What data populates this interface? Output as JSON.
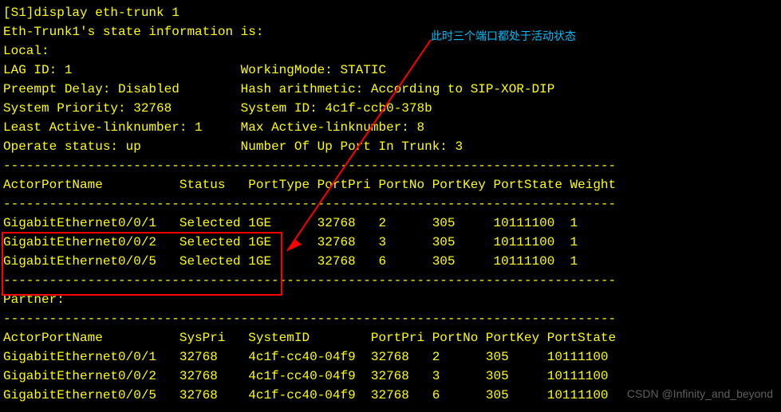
{
  "command": "[S1]display eth-trunk 1",
  "header": "Eth-Trunk1's state information is:",
  "annotation": "此时三个端口都处于活动状态",
  "local_label": "Local:",
  "info": {
    "lag_id_label": "LAG ID: 1",
    "working_mode_label": "WorkingMode: STATIC",
    "preempt_label": "Preempt Delay: Disabled",
    "hash_label": "Hash arithmetic: According to SIP-XOR-DIP",
    "sys_priority_label": "System Priority: 32768",
    "sys_id_label": "System ID: 4c1f-ccb0-378b",
    "least_active_label": "Least Active-linknumber: 1",
    "max_active_label": "Max Active-linknumber: 8",
    "operate_status_label": "Operate status: up",
    "up_ports_label": "Number Of Up Port In Trunk: 3"
  },
  "divider": "--------------------------------------------------------------------------------",
  "actor_headers": "ActorPortName          Status   PortType PortPri PortNo PortKey PortState Weight",
  "actor_rows": [
    "GigabitEthernet0/0/1   Selected 1GE      32768   2      305     10111100  1",
    "GigabitEthernet0/0/2   Selected 1GE      32768   3      305     10111100  1",
    "GigabitEthernet0/0/5   Selected 1GE      32768   6      305     10111100  1"
  ],
  "partner_label": "Partner:",
  "partner_headers": "ActorPortName          SysPri   SystemID        PortPri PortNo PortKey PortState",
  "partner_rows": [
    "GigabitEthernet0/0/1   32768    4c1f-cc40-04f9  32768   2      305     10111100",
    "GigabitEthernet0/0/2   32768    4c1f-cc40-04f9  32768   3      305     10111100",
    "GigabitEthernet0/0/5   32768    4c1f-cc40-04f9  32768   6      305     10111100"
  ],
  "watermark": "CSDN @Infinity_and_beyond"
}
